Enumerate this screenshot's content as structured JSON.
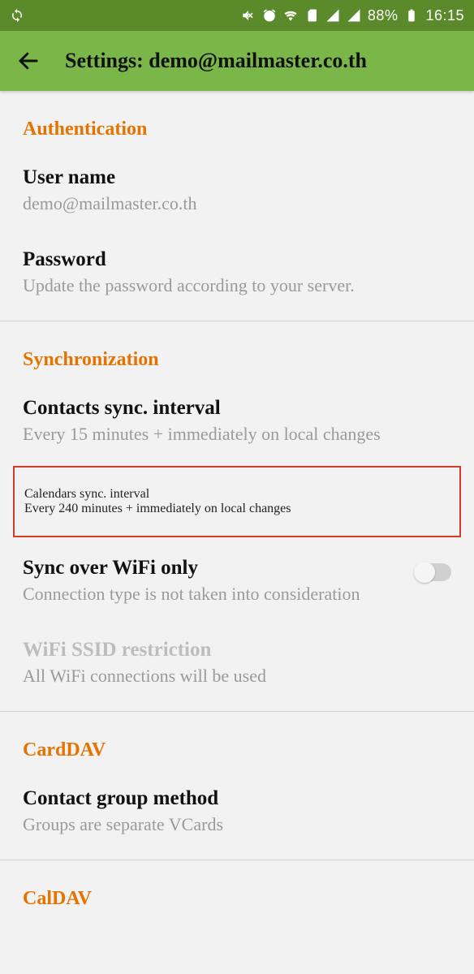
{
  "status_bar": {
    "battery_pct": "88%",
    "clock": "16:15"
  },
  "app_bar": {
    "title": "Settings: demo@mailmaster.co.th"
  },
  "sections": {
    "auth": {
      "header": "Authentication",
      "username": {
        "title": "User name",
        "sub": "demo@mailmaster.co.th"
      },
      "password": {
        "title": "Password",
        "sub": "Update the password according to your server."
      }
    },
    "sync": {
      "header": "Synchronization",
      "contacts": {
        "title": "Contacts sync. interval",
        "sub": "Every 15 minutes + immediately on local changes"
      },
      "calendars": {
        "title": "Calendars sync. interval",
        "sub": "Every 240 minutes + immediately on local changes"
      },
      "wifi_only": {
        "title": "Sync over WiFi only",
        "sub": "Connection type is not taken into consideration"
      },
      "ssid": {
        "title": "WiFi SSID restriction",
        "sub": "All WiFi connections will be used"
      }
    },
    "carddav": {
      "header": "CardDAV",
      "group_method": {
        "title": "Contact group method",
        "sub": "Groups are separate VCards"
      }
    },
    "caldav": {
      "header": "CalDAV"
    }
  }
}
